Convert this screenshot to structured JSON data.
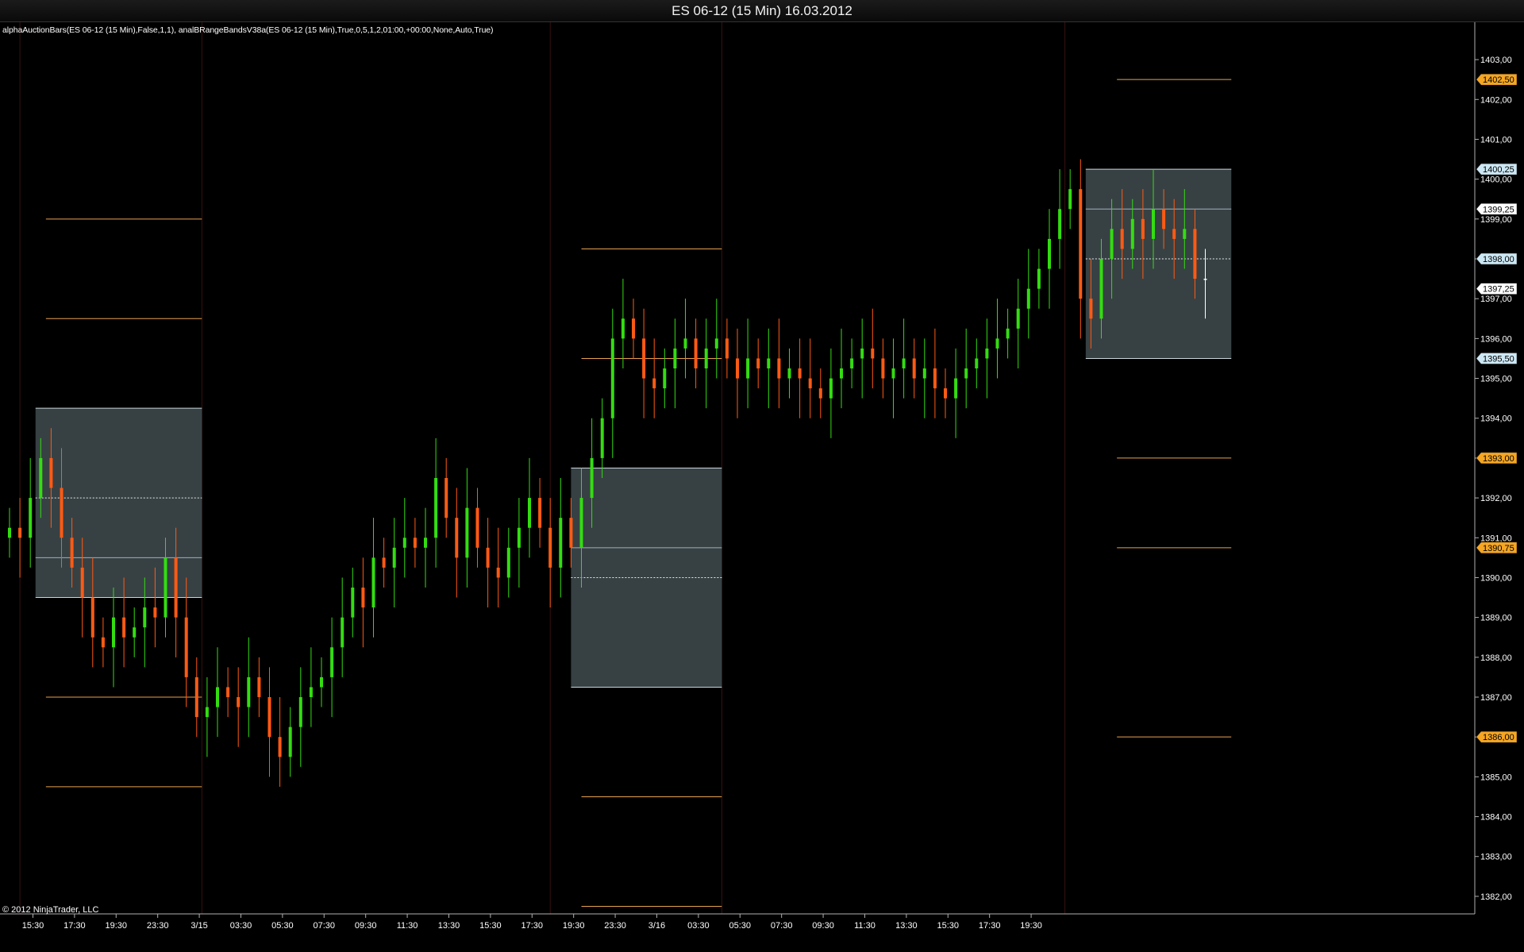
{
  "window": {
    "title": "ES 06-12 (15 Min)  16.03.2012"
  },
  "indicator_label": "alphaAuctionBars(ES 06-12 (15 Min),False,1,1), analBRangeBandsV38a(ES 06-12 (15 Min),True,0,5,1,2,01:00,+00:00,None,Auto,True)",
  "copyright": "© 2012 NinjaTrader, LLC",
  "colors": {
    "background": "#000000",
    "up_candle": "#33dd11",
    "down_candle": "#ff5a14",
    "doji": "#ffffff",
    "band_line": "#e8a050",
    "range_box": "#3a4448",
    "session_divider": "#3a1010",
    "price_marker_orange": "#f5a623",
    "price_marker_blue": "#cde8f5"
  },
  "chart_data": {
    "type": "candlestick",
    "symbol": "ES 06-12",
    "interval": "15 Min",
    "date": "16.03.2012",
    "ylim": [
      1381.5,
      1403.5
    ],
    "y_ticks": [
      "1382,00",
      "1383,00",
      "1384,00",
      "1385,00",
      "1386,00",
      "1387,00",
      "1388,00",
      "1389,00",
      "1390,00",
      "1391,00",
      "1392,00",
      "1393,00",
      "1394,00",
      "1395,00",
      "1396,00",
      "1397,00",
      "1398,00",
      "1399,00",
      "1400,00",
      "1401,00",
      "1402,00",
      "1403,00"
    ],
    "x_ticks": [
      "15:30",
      "17:30",
      "19:30",
      "23:30",
      "3/15",
      "03:30",
      "05:30",
      "07:30",
      "09:30",
      "11:30",
      "13:30",
      "15:30",
      "17:30",
      "19:30",
      "23:30",
      "3/16",
      "03:30",
      "05:30",
      "07:30",
      "09:30",
      "11:30",
      "13:30",
      "15:30",
      "17:30",
      "19:30"
    ],
    "session_boundaries": [
      1,
      18.5,
      52,
      68.5,
      101.5
    ],
    "range_boxes": [
      {
        "x_start": 2.5,
        "x_end": 18.5,
        "low": 1389.5,
        "high": 1394.25,
        "mid": 1392.0,
        "level": 1390.5
      },
      {
        "x_start": 54,
        "x_end": 68.5,
        "low": 1387.25,
        "high": 1392.75,
        "mid": 1390.0,
        "level": 1390.75
      },
      {
        "x_start": 103.5,
        "x_end": 117.5,
        "low": 1395.5,
        "high": 1400.25,
        "mid": 1398.0,
        "level": 1399.25
      }
    ],
    "band_lines": [
      {
        "x_start": 3.5,
        "x_end": 18.5,
        "price": 1399.0
      },
      {
        "x_start": 3.5,
        "x_end": 18.5,
        "price": 1396.5
      },
      {
        "x_start": 3.5,
        "x_end": 18.5,
        "price": 1387.0
      },
      {
        "x_start": 3.5,
        "x_end": 18.5,
        "price": 1384.75
      },
      {
        "x_start": 55,
        "x_end": 68.5,
        "price": 1398.25
      },
      {
        "x_start": 55,
        "x_end": 68.5,
        "price": 1395.5
      },
      {
        "x_start": 55,
        "x_end": 68.5,
        "price": 1384.5
      },
      {
        "x_start": 55,
        "x_end": 68.5,
        "price": 1381.75
      },
      {
        "x_start": 106.5,
        "x_end": 117.5,
        "price": 1402.5
      },
      {
        "x_start": 106.5,
        "x_end": 117.5,
        "price": 1393.0
      },
      {
        "x_start": 106.5,
        "x_end": 117.5,
        "price": 1390.75
      },
      {
        "x_start": 106.5,
        "x_end": 117.5,
        "price": 1386.0
      }
    ],
    "price_markers": [
      {
        "price": 1402.5,
        "label": "1402,50",
        "style": "orange"
      },
      {
        "price": 1400.25,
        "label": "1400,25",
        "style": "blue"
      },
      {
        "price": 1399.25,
        "label": "1399,25",
        "style": "white"
      },
      {
        "price": 1398.0,
        "label": "1398,00",
        "style": "blue"
      },
      {
        "price": 1397.25,
        "label": "1397,25",
        "style": "white"
      },
      {
        "price": 1395.5,
        "label": "1395,50",
        "style": "blue"
      },
      {
        "price": 1393.0,
        "label": "1393,00",
        "style": "orange"
      },
      {
        "price": 1390.75,
        "label": "1390,75",
        "style": "orange"
      },
      {
        "price": 1386.0,
        "label": "1386,00",
        "style": "orange"
      }
    ],
    "closes": [
      1391.25,
      1391.0,
      1392.0,
      1393.0,
      1392.25,
      1391.0,
      1390.25,
      1389.5,
      1388.5,
      1388.25,
      1389.0,
      1388.5,
      1388.75,
      1389.25,
      1389.0,
      1390.5,
      1389.0,
      1387.5,
      1386.5,
      1386.75,
      1387.25,
      1387.0,
      1386.75,
      1387.5,
      1387.0,
      1386.0,
      1385.5,
      1386.25,
      1387.0,
      1387.25,
      1387.5,
      1388.25,
      1389.0,
      1389.75,
      1389.25,
      1390.5,
      1390.25,
      1390.75,
      1391.0,
      1390.75,
      1391.0,
      1392.5,
      1391.5,
      1390.5,
      1391.75,
      1390.75,
      1390.25,
      1390.0,
      1390.75,
      1391.25,
      1392.0,
      1391.25,
      1390.25,
      1391.5,
      1390.75,
      1392.0,
      1393.0,
      1394.0,
      1396.0,
      1396.5,
      1396.0,
      1395.0,
      1394.75,
      1395.25,
      1395.75,
      1396.0,
      1395.25,
      1395.75,
      1396.0,
      1395.5,
      1395.0,
      1395.5,
      1395.25,
      1395.5,
      1395.0,
      1395.25,
      1395.0,
      1394.75,
      1394.5,
      1395.0,
      1395.25,
      1395.5,
      1395.75,
      1395.5,
      1395.0,
      1395.25,
      1395.5,
      1395.0,
      1395.25,
      1394.75,
      1394.5,
      1395.0,
      1395.25,
      1395.5,
      1395.75,
      1396.0,
      1396.25,
      1396.75,
      1397.25,
      1397.75,
      1398.5,
      1399.25,
      1399.75,
      1397.0,
      1396.5,
      1398.0,
      1398.75,
      1398.25,
      1399.0,
      1398.5,
      1399.25,
      1398.75,
      1398.5,
      1398.75,
      1397.5,
      1397.5
    ]
  }
}
